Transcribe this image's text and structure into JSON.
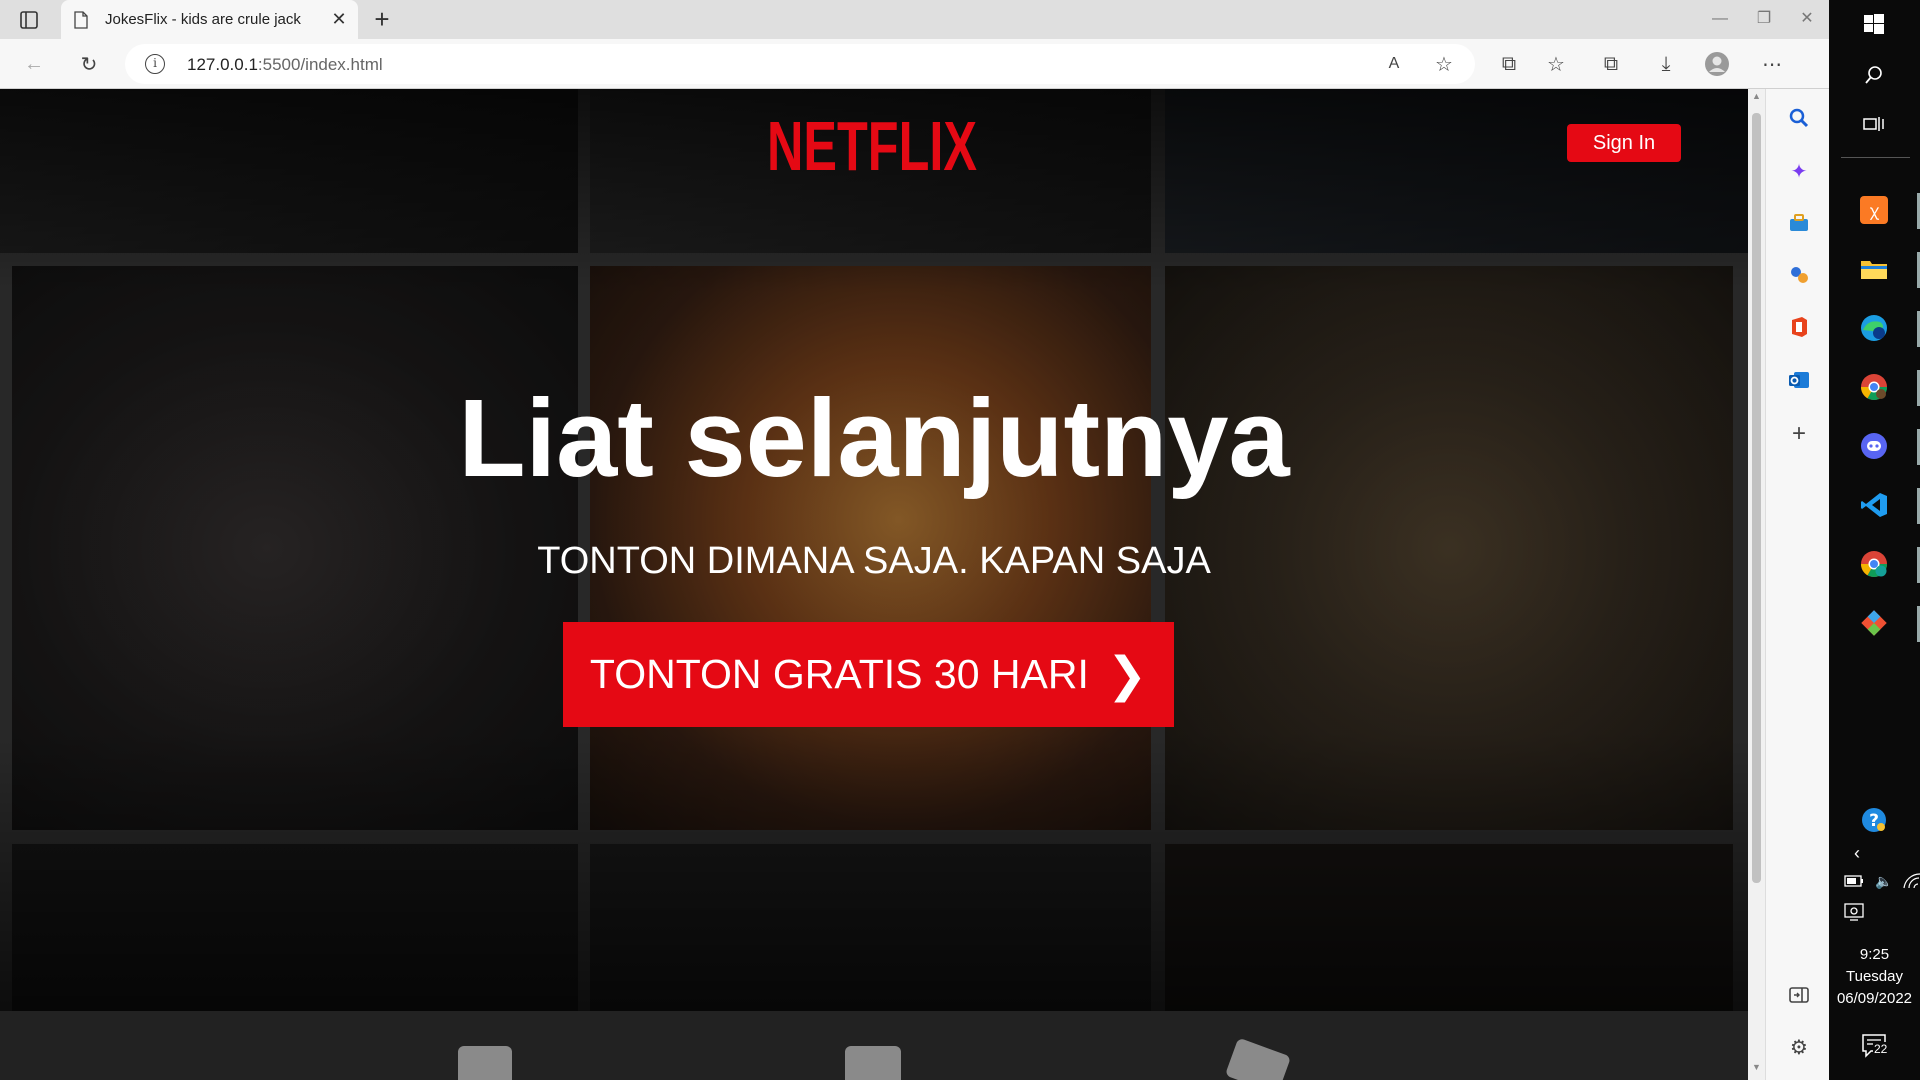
{
  "browser": {
    "tab": {
      "title": "JokesFlix - kids are crule jack",
      "close": "✕"
    },
    "new_tab": "+",
    "window_controls": {
      "minimize": "—",
      "restore": "❐",
      "close": "✕"
    },
    "address": {
      "host": "127.0.0.1",
      "rest": ":5500/index.html"
    },
    "toolbar_icons": {
      "back": "←",
      "refresh": "↻",
      "read_aloud": "A",
      "add_favorite": "☆",
      "extensions": "⧉",
      "favorites": "☆",
      "collections": "⧉",
      "downloads": "⤓",
      "more": "⋯"
    }
  },
  "page": {
    "logo": "NETFLIX",
    "sign_in": "Sign In",
    "headline": "Liat selanjutnya",
    "subheadline": "TONTON DIMANA SAJA. KAPAN SAJA",
    "cta": {
      "label": "TONTON GRATIS 30 HARI",
      "chevron": "❯"
    }
  },
  "sidepanel": {
    "icons": [
      "search-icon",
      "sparkle-icon",
      "toolbox-icon",
      "games-icon",
      "office-icon",
      "outlook-icon",
      "add-icon"
    ],
    "bottom_icons": [
      "split-screen-icon",
      "settings-icon"
    ]
  },
  "taskbar": {
    "clock": {
      "time": "9:25",
      "day": "Tuesday",
      "date": "06/09/2022"
    },
    "notifications": "22",
    "apps": [
      "xampp-icon",
      "file-explorer-icon",
      "edge-icon",
      "chrome-icon",
      "discord-icon",
      "vscode-icon",
      "chrome-profile-icon",
      "git-icon"
    ]
  },
  "colors": {
    "brand_red": "#e50914",
    "taskbar": "#0a0a0a",
    "chrome_bg": "#f7f7f7"
  }
}
